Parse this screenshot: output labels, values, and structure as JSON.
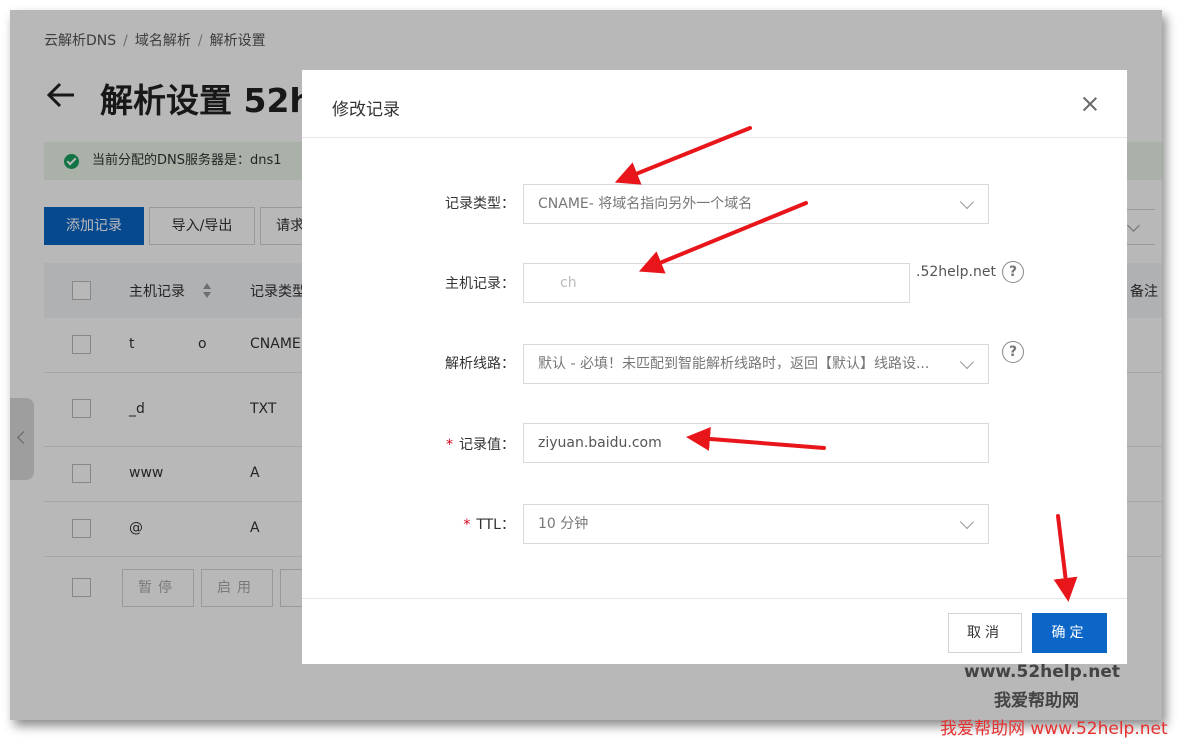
{
  "breadcrumb": [
    "云解析DNS",
    "域名解析",
    "解析设置"
  ],
  "page": {
    "title": "解析设置 52h",
    "notice": "当前分配的DNS服务器是：dns1"
  },
  "toolbar": {
    "add_record": "添加记录",
    "import_export": "导入/导出",
    "third_btn": "请求"
  },
  "table": {
    "headers": [
      "主机记录",
      "记录类型",
      "备注"
    ],
    "rows": [
      {
        "host": "t",
        "host_tail": "o",
        "type": "CNAME"
      },
      {
        "host": "_d",
        "host_tail": "",
        "type": "TXT"
      },
      {
        "host": "www",
        "host_tail": "",
        "type": "A"
      },
      {
        "host": "@",
        "host_tail": "",
        "type": "A"
      }
    ],
    "footer_buttons": [
      "暂停",
      "启用"
    ]
  },
  "modal": {
    "title": "修改记录",
    "fields": {
      "record_type": {
        "label": "记录类型：",
        "value": "CNAME- 将域名指向另外一个域名"
      },
      "host_record": {
        "label": "主机记录：",
        "value": "ch",
        "suffix": ".52help.net"
      },
      "line": {
        "label": "解析线路：",
        "value": "默认 - 必填！未匹配到智能解析线路时，返回【默认】线路设..."
      },
      "record_value": {
        "label": "记录值：",
        "value": "ziyuan.baidu.com",
        "required": "*"
      },
      "ttl": {
        "label": "TTL：",
        "value": "10 分钟",
        "required": "*"
      }
    },
    "cancel": "取消",
    "confirm": "确定"
  },
  "watermark": {
    "line1": "www.52help.net",
    "line2": "我爱帮助网",
    "line3": "我爱帮助网 www.52help.net"
  },
  "colors": {
    "primary": "#0b66c7",
    "arrow": "#e8161b",
    "required": "#d9001b",
    "success": "#19a15f"
  }
}
